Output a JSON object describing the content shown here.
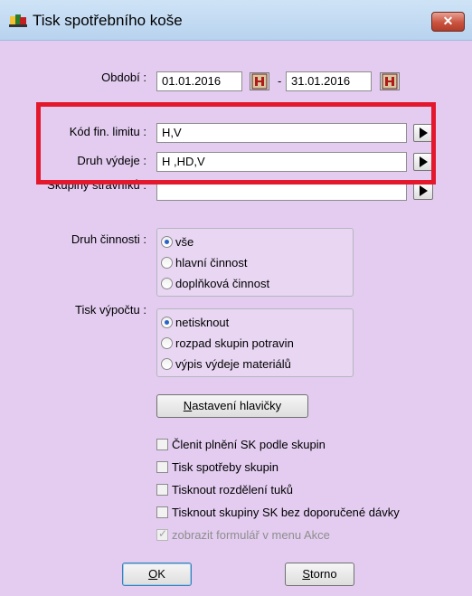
{
  "window": {
    "title": "Tisk spotřebního koše",
    "close_glyph": "✕",
    "icon": "report-icon"
  },
  "period": {
    "label": "Období :",
    "from": "01.01.2016",
    "separator": "-",
    "to": "31.01.2016"
  },
  "fin_limit": {
    "label": "Kód fin. limitu :",
    "value": "H,V"
  },
  "issue_type": {
    "label": "Druh výdeje :",
    "value": "H ,HD,V"
  },
  "diner_groups": {
    "label": "Skupiny strávníků :",
    "value": ""
  },
  "activity": {
    "label": "Druh činnosti :",
    "options": [
      "vše",
      "hlavní činnost",
      "doplňková činnost"
    ],
    "selected": "vše"
  },
  "calc_print": {
    "label": "Tisk výpočtu :",
    "options": [
      "netisknout",
      "rozpad skupin potravin",
      "výpis výdeje materiálů"
    ],
    "selected": "netisknout"
  },
  "header_button": {
    "accel": "N",
    "rest": "astavení hlavičky"
  },
  "checkboxes": [
    {
      "label": "Členit plnění SK podle skupin",
      "checked": false
    },
    {
      "label": "Tisk spotřeby skupin",
      "checked": false
    },
    {
      "label": "Tisknout rozdělení tuků",
      "checked": false
    },
    {
      "label": "Tisknout skupiny SK bez doporučené dávky",
      "checked": false
    },
    {
      "label": "zobrazit formulář v menu Akce",
      "checked": true,
      "disabled": true
    }
  ],
  "ok_button": {
    "accel": "O",
    "rest": "K"
  },
  "cancel_button": {
    "accel": "S",
    "rest": "torno"
  },
  "colors": {
    "background": "#e3ccf0",
    "highlight": "#e3182d",
    "close": "#c9533f"
  }
}
